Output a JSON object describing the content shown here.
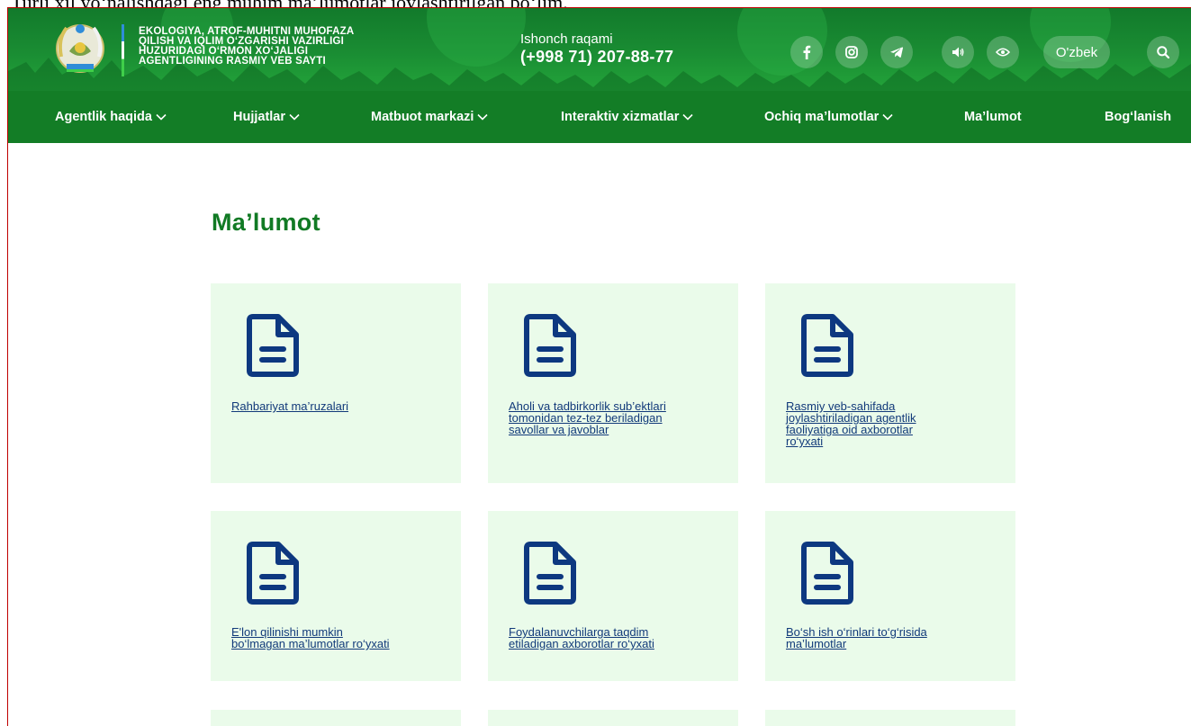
{
  "page_caption": "Turli xil yo‘nalishdagi eng muhim ma’lumotlar joylashtirilgan bo‘lim.",
  "header": {
    "agency_name_lines": [
      "EKOLOGIYA, ATROF-MUHITNI MUHOFAZA",
      "QILISH VA IQLIM O‘ZGARISHI VAZIRLIGI",
      "HUZURIDAGI O‘RMON XO‘JALIGI",
      "AGENTLIGINING RASMIY VEB SAYTI"
    ],
    "hotline_label": "Ishonch raqami",
    "hotline_number": "(+998 71) 207-88-77",
    "language": "O'zbek",
    "icons": [
      "facebook-icon",
      "instagram-icon",
      "telegram-icon",
      "speaker-icon",
      "eye-icon",
      "search-icon"
    ]
  },
  "nav": {
    "items": [
      {
        "label": "Agentlik haqida",
        "dropdown": true
      },
      {
        "label": "Hujjatlar",
        "dropdown": true
      },
      {
        "label": "Matbuot markazi",
        "dropdown": true
      },
      {
        "label": "Interaktiv xizmatlar",
        "dropdown": true
      },
      {
        "label": "Ochiq ma’lumotlar",
        "dropdown": true
      },
      {
        "label": "Ma’lumot",
        "dropdown": false
      },
      {
        "label": "Bog‘lanish",
        "dropdown": false
      }
    ]
  },
  "main": {
    "title": "Ma’lumot",
    "cards": [
      {
        "lines": [
          "Rahbariyat ma’ruzalari"
        ]
      },
      {
        "lines": [
          "Aholi va tadbirkorlik sub’ektlari",
          "tomonidan tez-tez beriladigan",
          "savollar va javoblar"
        ]
      },
      {
        "lines": [
          "Rasmiy veb-sahifada",
          "joylashtiriladigan agentlik",
          "faoliyatiga oid axborotlar",
          "ro‘yxati"
        ]
      },
      {
        "lines": [
          "E'lon qilinishi mumkin",
          "bo‘lmagan ma’lumotlar ro‘yxati"
        ]
      },
      {
        "lines": [
          "Foydalanuvchilarga taqdim",
          "etiladigan axborotlar ro‘yxati"
        ]
      },
      {
        "lines": [
          "Bo‘sh ish o‘rinlari to‘g‘risida",
          "ma’lumotlar"
        ]
      }
    ]
  },
  "colors": {
    "header_green": "#1a8d33",
    "nav_green": "#137d26",
    "title_green": "#117a24",
    "card_bg": "#eafbea",
    "link_blue": "#123a7a",
    "icon_blue": "#0d3880"
  }
}
